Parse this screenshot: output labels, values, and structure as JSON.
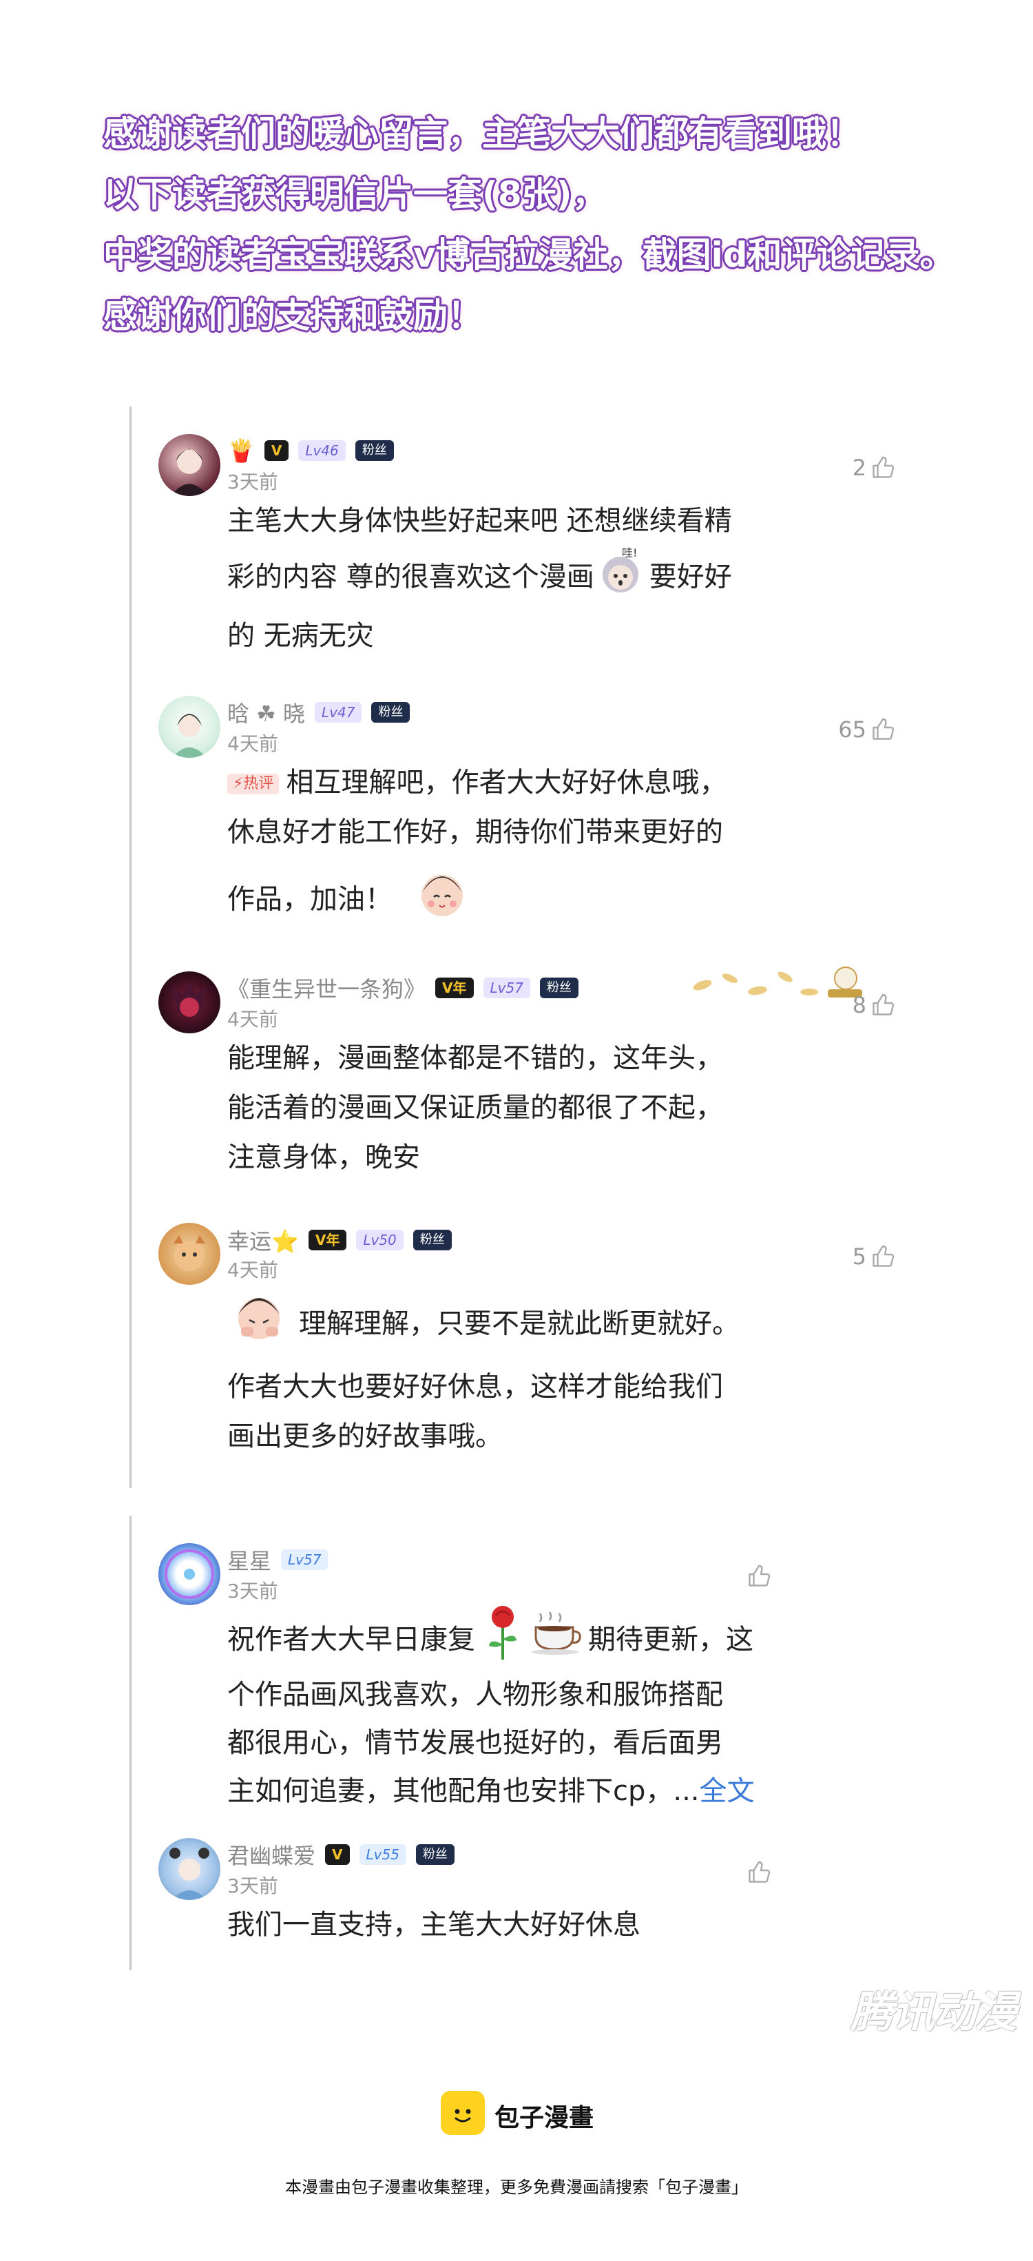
{
  "banner": {
    "lines": [
      "感谢读者们的暖心留言，主笔大大们都有看到哦！",
      "以下读者获得明信片一套(8张)，",
      "中奖的读者宝宝联系v博古拉漫社，截图id和评论记录。",
      "感谢你们的支持和鼓励！"
    ]
  },
  "comments": [
    {
      "name": "",
      "badges": [
        "V",
        "Lv46",
        "粉丝"
      ],
      "time": "3天前",
      "likes": "2",
      "text_1": "主笔大大身体快些好起来吧 还想继续看精",
      "text_2": "彩的内容 尊的很喜欢这个漫画",
      "text_3": "要好好",
      "text_4": "的 无病无灾",
      "sticker_label": "哇!"
    },
    {
      "name": "晗 ☘ 晓",
      "badges": [
        "Lv47",
        "粉丝"
      ],
      "time": "4天前",
      "likes": "65",
      "hot": "热评",
      "text_1": "相互理解吧，作者大大好好休息哦，",
      "text_2": "休息好才能工作好，期待你们带来更好的",
      "text_3": "作品，加油！"
    },
    {
      "name": "《重生异世一条狗》",
      "badges": [
        "V年",
        "Lv57",
        "粉丝"
      ],
      "time": "4天前",
      "likes": "8",
      "text_1": "能理解，漫画整体都是不错的，这年头，",
      "text_2": "能活着的漫画又保证质量的都很了不起，",
      "text_3": "注意身体，晚安"
    },
    {
      "name": "幸运⭐",
      "badges": [
        "V年",
        "Lv50",
        "粉丝"
      ],
      "time": "4天前",
      "likes": "5",
      "text_1": "理解理解，只要不是就此断更就好。",
      "text_2": "作者大大也要好好休息，这样才能给我们",
      "text_3": "画出更多的好故事哦。"
    },
    {
      "name": "星星",
      "badges": [
        "Lv57"
      ],
      "time": "3天前",
      "likes": "",
      "text_1": "祝作者大大早日康复",
      "text_1b": "期待更新，这",
      "text_2": "个作品画风我喜欢，人物形象和服饰搭配",
      "text_3": "都很用心，情节发展也挺好的，看后面男",
      "text_4": "主如何追妻，其他配角也安排下cp，...",
      "more": "全文"
    },
    {
      "name": "君幽蝶爱",
      "badges": [
        "V",
        "Lv55",
        "粉丝"
      ],
      "time": "3天前",
      "likes": "",
      "text_1": "我们一直支持，主笔大大好好休息"
    }
  ],
  "watermark": "腾讯动漫",
  "footer": {
    "brand": "包子漫畫",
    "note": "本漫畫由包子漫畫收集整理，更多免費漫画請搜索「包子漫畫」"
  },
  "colors": {
    "banner_outline": "#7a3fb5",
    "brand_yellow": "#ffd21f",
    "link_blue": "#3a7ad9",
    "hot_red": "#e0534b"
  }
}
